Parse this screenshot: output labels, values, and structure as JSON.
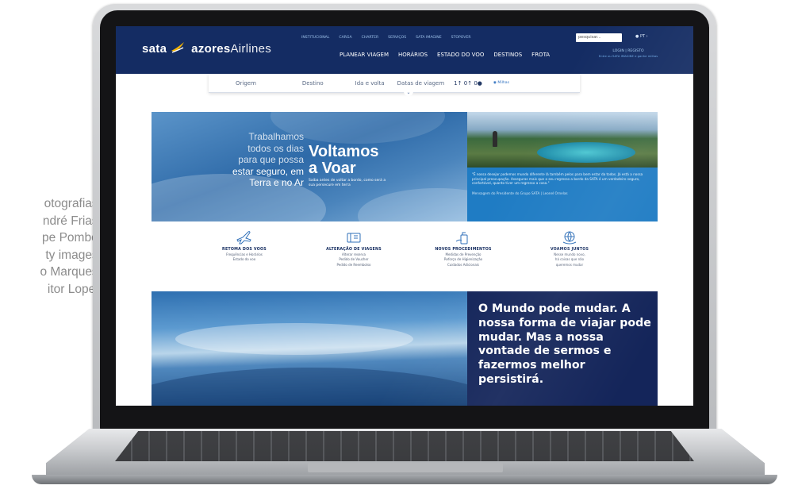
{
  "photo_credits": [
    "otografias:",
    "ndré Frias;",
    "pe Pombo;",
    "ty images;",
    "o Marques;",
    "itor Lopes"
  ],
  "header": {
    "logo_sata": "sata",
    "logo_azores": "azores",
    "logo_airlines": "Airlines",
    "top_links": [
      "INSTITUCIONAL",
      "CARGA",
      "CHARTER",
      "SERVIÇOS",
      "SATA IMAGINE",
      "STOPOVER"
    ],
    "search_placeholder": "pesquisar...",
    "language": "PT",
    "main_nav": [
      "PLANEAR VIAGEM",
      "HORÁRIOS",
      "ESTADO DO VOO",
      "DESTINOS",
      "FROTA"
    ],
    "login": "LOGIN | REGISTO",
    "login_sub": "Entre ou SATA IMAGINE e ganhe milhas"
  },
  "booking_bar": {
    "origin": "Origem",
    "destination": "Destino",
    "trip_type": "Ida e volta",
    "dates": "Datas de viagem",
    "adults": "1",
    "children": "0",
    "infants": "0",
    "option": "Milhas"
  },
  "hero": {
    "lines": [
      "Trabalhamos",
      "todos os dias",
      "para que possa",
      "estar seguro, em",
      "Terra e no Ar"
    ],
    "title_line1": "Voltamos",
    "title_line2": "a Voar",
    "subtitle": "Saiba antes de voltar a bordo, como será a sua persecure em terra",
    "quote": "\"É nossa desejar podemos mundo diferente lá também pelos para bem estar da todos. Já está a nossa principal preocupação. Asseguras mais que o seu regresso a bordo da SATA é um verdadeiro seguro, confortável, quanto tiver um regresso a casa.\"",
    "caption": "Mensagem do Presidente do Grupo SATA | Leonel Ornelas"
  },
  "tiles": [
    {
      "title": "RETOMA DOS VOOS",
      "lines": [
        "Frequências e Horários",
        "Estado do voo"
      ],
      "icon": "plane-icon"
    },
    {
      "title": "ALTERAÇÃO DE VIAGENS",
      "lines": [
        "Alterar reserva",
        "Pedido de Voucher",
        "Pedido de Reembolso"
      ],
      "icon": "ticket-icon"
    },
    {
      "title": "NOVOS PROCEDIMENTOS",
      "lines": [
        "Medidas de Prevenção",
        "Reforço de Higienização",
        "Cuidados Adicionais"
      ],
      "icon": "hand-sanitizer-icon"
    },
    {
      "title": "VOAMOS JUNTOS",
      "lines": [
        "Nesse mundo novo,",
        "há coisas que não",
        "queremos mudar"
      ],
      "icon": "globe-hands-icon"
    }
  ],
  "closing_quote": "O Mundo pode mudar. A nossa forma de viajar pode mudar. Mas a nossa vontade de sermos e fazermos melhor persistirá.",
  "colors": {
    "navy": "#142c63",
    "hero_blue": "#1f7cc4",
    "text_blue": "#122a5e"
  }
}
